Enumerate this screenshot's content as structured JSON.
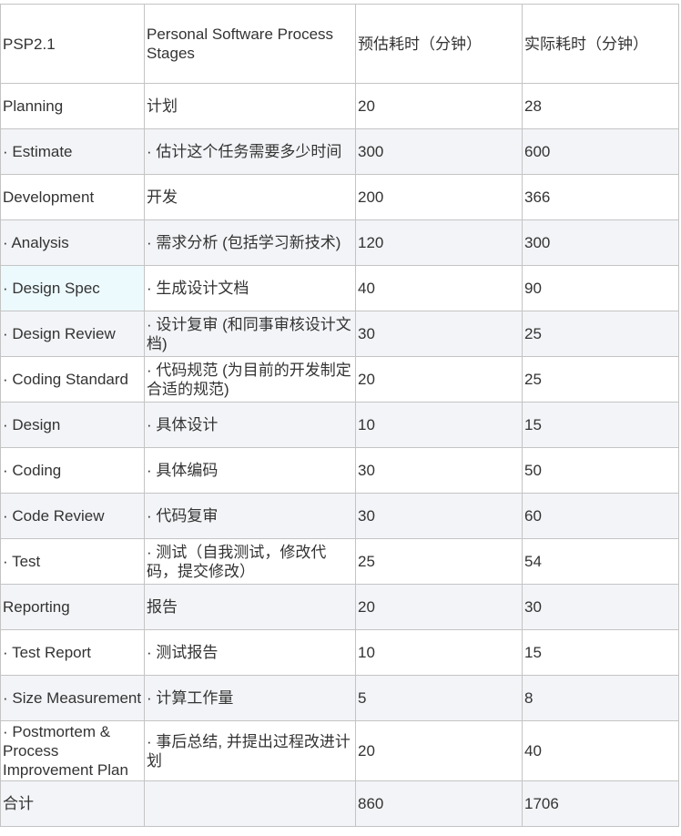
{
  "table": {
    "header": [
      "PSP2.1",
      "Personal Software Process Stages",
      "预估耗时（分钟）",
      "实际耗时（分钟）"
    ],
    "rows": [
      [
        "Planning",
        "计划",
        "20",
        "28"
      ],
      [
        "· Estimate",
        "· 估计这个任务需要多少时间",
        "300",
        "600"
      ],
      [
        "Development",
        "开发",
        "200",
        "366"
      ],
      [
        "· Analysis",
        "· 需求分析 (包括学习新技术)",
        "120",
        "300"
      ],
      [
        "· Design Spec",
        "· 生成设计文档",
        "40",
        "90"
      ],
      [
        "· Design Review",
        "· 设计复审 (和同事审核设计文档)",
        "30",
        "25"
      ],
      [
        "· Coding Standard",
        "· 代码规范 (为目前的开发制定合适的规范)",
        "20",
        "25"
      ],
      [
        "· Design",
        "· 具体设计",
        "10",
        "15"
      ],
      [
        "· Coding",
        "· 具体编码",
        "30",
        "50"
      ],
      [
        "· Code Review",
        "· 代码复审",
        "30",
        "60"
      ],
      [
        "· Test",
        "· 测试（自我测试，修改代码，提交修改）",
        "25",
        "54"
      ],
      [
        "Reporting",
        "报告",
        "20",
        "30"
      ],
      [
        "· Test Report",
        "· 测试报告",
        "10",
        "15"
      ],
      [
        "· Size Measurement",
        "· 计算工作量",
        "5",
        "8"
      ],
      [
        "· Postmortem & Process Improvement Plan",
        "· 事后总结, 并提出过程改进计划",
        "20",
        "40"
      ]
    ],
    "total": [
      "合计",
      "",
      "860",
      "1706"
    ]
  }
}
